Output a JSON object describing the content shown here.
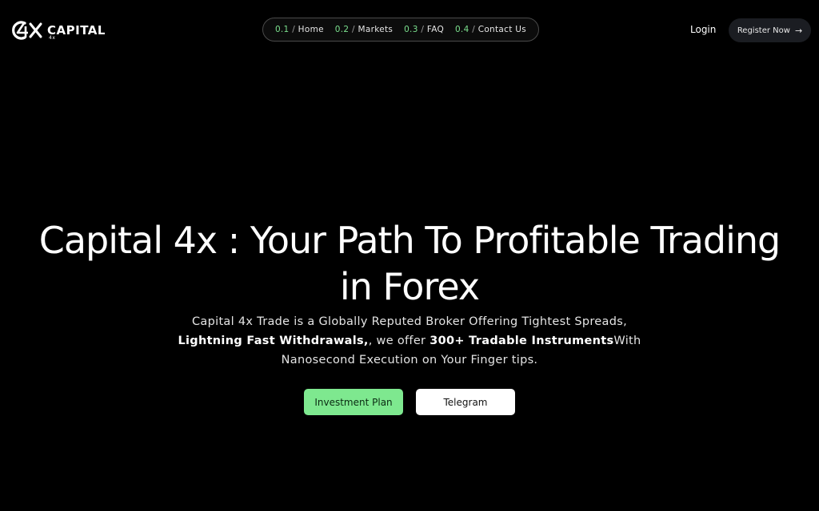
{
  "brand": {
    "name": "CAPITAL",
    "sub": "4x",
    "mark_text": "4X"
  },
  "nav": {
    "items": [
      {
        "num": "0.1",
        "label": "Home"
      },
      {
        "num": "0.2",
        "label": "Markets"
      },
      {
        "num": "0.3",
        "label": "FAQ"
      },
      {
        "num": "0.4",
        "label": "Contact Us"
      }
    ],
    "separator": "/"
  },
  "header": {
    "login_label": "Login",
    "register_label": "Register Now"
  },
  "hero": {
    "title_line1": "Capital 4x : Your Path To Profitable Trading",
    "title_line2": "in Forex",
    "sub_part1": "Capital 4x Trade is a Globally Reputed Broker Offering Tightest Spreads, ",
    "sub_bold1": "Lightning Fast Withdrawals,",
    "sub_part2": ", we offer ",
    "sub_bold2": "300+ Tradable Instruments",
    "sub_part3": "With Nanosecond Execution on Your Finger tips.",
    "invest_label": "Investment Plan",
    "telegram_label": "Telegram"
  },
  "colors": {
    "background": "#000000",
    "accent_green": "#7ee88f",
    "nav_number": "#7be08e",
    "register_bg": "#1b1d22"
  },
  "icons": {
    "register_arrow": "arrow-right-icon",
    "logo": "capital-4x-logo-icon"
  }
}
